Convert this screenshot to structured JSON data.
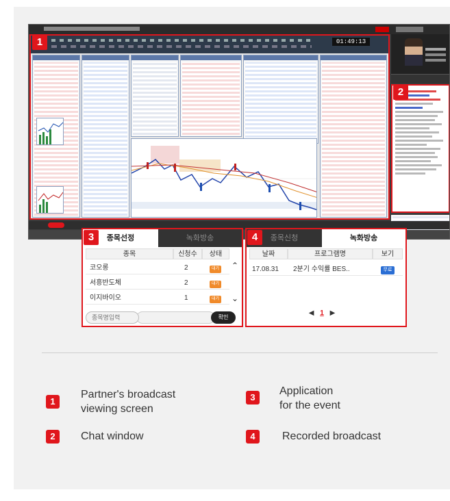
{
  "colors": {
    "accent": "#e0161c",
    "tag": "#f08a2a",
    "play": "#2a6ed4"
  },
  "app": {
    "clock": "01:49:13"
  },
  "badges": {
    "b1": "1",
    "b2": "2",
    "b3": "3",
    "b4": "4"
  },
  "panel3": {
    "tab_active": "종목선정",
    "tab_inactive": "녹화방송",
    "headers": [
      "종목",
      "신청수",
      "상태"
    ],
    "rows": [
      {
        "name": "코오롱",
        "count": "2",
        "status": "대기"
      },
      {
        "name": "서흥반도체",
        "count": "2",
        "status": "대기"
      },
      {
        "name": "이지바이오",
        "count": "1",
        "status": "대기"
      }
    ],
    "search_placeholder": "종목명입력",
    "confirm_label": "확인"
  },
  "panel4": {
    "tab_inactive": "종목신청",
    "tab_active": "녹화방송",
    "headers": [
      "날짜",
      "프로그램명",
      "보기"
    ],
    "rows": [
      {
        "date": "17.08.31",
        "program": "2분기 수익률 BES..",
        "view": "무료"
      }
    ],
    "pager": {
      "prev": "◀",
      "current": "1",
      "next": "▶"
    }
  },
  "legend": [
    {
      "num": "1",
      "line1": "Partner's broadcast",
      "line2": "viewing screen"
    },
    {
      "num": "2",
      "line1": "Chat window",
      "line2": ""
    },
    {
      "num": "3",
      "line1": "Application",
      "line2": "for the event"
    },
    {
      "num": "4",
      "line1": "Recorded broadcast",
      "line2": ""
    }
  ],
  "icons": {
    "scroll_up": "chevron-up-icon",
    "scroll_down": "chevron-down-icon"
  }
}
